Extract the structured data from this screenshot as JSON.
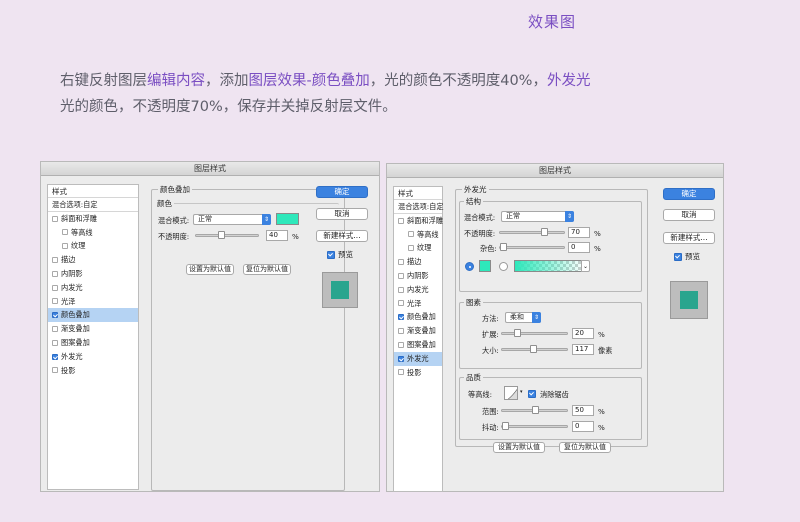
{
  "heading": "效果图",
  "instructions": {
    "p1": "右键反射图层",
    "h1": "编辑内容",
    "p2": "，添加",
    "h2": "图层效果-颜色叠加",
    "p3": "，光的颜色不透明度40%，",
    "h3": "外发光",
    "p4": "光的颜色，不透明度70%，保存并关掉反射层文件。"
  },
  "colors": {
    "accent": "#7a4ec2",
    "button_blue": "#3b82e0",
    "glow_color": "#2ee8bb",
    "preview_fill": "#2aa58e"
  },
  "dialog1": {
    "title": "图层样式",
    "list_header": "样式",
    "items": [
      {
        "label": "混合选项:自定",
        "checkbox": false,
        "checked": false,
        "sub": false,
        "selected": false
      },
      {
        "label": "斜面和浮雕",
        "checkbox": true,
        "checked": false,
        "sub": false,
        "selected": false
      },
      {
        "label": "等高线",
        "checkbox": true,
        "checked": false,
        "sub": true,
        "selected": false
      },
      {
        "label": "纹理",
        "checkbox": true,
        "checked": false,
        "sub": true,
        "selected": false
      },
      {
        "label": "描边",
        "checkbox": true,
        "checked": false,
        "sub": false,
        "selected": false
      },
      {
        "label": "内阴影",
        "checkbox": true,
        "checked": false,
        "sub": false,
        "selected": false
      },
      {
        "label": "内发光",
        "checkbox": true,
        "checked": false,
        "sub": false,
        "selected": false
      },
      {
        "label": "光泽",
        "checkbox": true,
        "checked": false,
        "sub": false,
        "selected": false
      },
      {
        "label": "颜色叠加",
        "checkbox": true,
        "checked": true,
        "sub": false,
        "selected": true
      },
      {
        "label": "渐变叠加",
        "checkbox": true,
        "checked": false,
        "sub": false,
        "selected": false
      },
      {
        "label": "图案叠加",
        "checkbox": true,
        "checked": false,
        "sub": false,
        "selected": false
      },
      {
        "label": "外发光",
        "checkbox": true,
        "checked": true,
        "sub": false,
        "selected": false
      },
      {
        "label": "投影",
        "checkbox": true,
        "checked": false,
        "sub": false,
        "selected": false
      }
    ],
    "section_title": "颜色叠加",
    "sub_title": "颜色",
    "blend_label": "混合模式:",
    "blend_value": "正常",
    "opacity_label": "不透明度:",
    "opacity_value": "40",
    "opacity_fraction": 0.4,
    "unit": "%",
    "btn_default": "设置为默认值",
    "btn_reset": "复位为默认值",
    "ok": "确定",
    "cancel": "取消",
    "new_style": "新建样式...",
    "preview": "预览"
  },
  "dialog2": {
    "title": "图层样式",
    "list_header": "样式",
    "items": [
      {
        "label": "混合选项:自定",
        "checkbox": false,
        "checked": false,
        "sub": false,
        "selected": false
      },
      {
        "label": "斜面和浮雕",
        "checkbox": true,
        "checked": false,
        "sub": false,
        "selected": false
      },
      {
        "label": "等高线",
        "checkbox": true,
        "checked": false,
        "sub": true,
        "selected": false
      },
      {
        "label": "纹理",
        "checkbox": true,
        "checked": false,
        "sub": true,
        "selected": false
      },
      {
        "label": "描边",
        "checkbox": true,
        "checked": false,
        "sub": false,
        "selected": false
      },
      {
        "label": "内阴影",
        "checkbox": true,
        "checked": false,
        "sub": false,
        "selected": false
      },
      {
        "label": "内发光",
        "checkbox": true,
        "checked": false,
        "sub": false,
        "selected": false
      },
      {
        "label": "光泽",
        "checkbox": true,
        "checked": false,
        "sub": false,
        "selected": false
      },
      {
        "label": "颜色叠加",
        "checkbox": true,
        "checked": true,
        "sub": false,
        "selected": false
      },
      {
        "label": "渐变叠加",
        "checkbox": true,
        "checked": false,
        "sub": false,
        "selected": false
      },
      {
        "label": "图案叠加",
        "checkbox": true,
        "checked": false,
        "sub": false,
        "selected": false
      },
      {
        "label": "外发光",
        "checkbox": true,
        "checked": true,
        "sub": false,
        "selected": true
      },
      {
        "label": "投影",
        "checkbox": true,
        "checked": false,
        "sub": false,
        "selected": false
      }
    ],
    "section_title": "外发光",
    "structure": {
      "title": "结构",
      "blend_label": "混合模式:",
      "blend_value": "正常",
      "opacity_label": "不透明度:",
      "opacity_value": "70",
      "opacity_fraction": 0.7,
      "noise_label": "杂色:",
      "noise_value": "0",
      "noise_fraction": 0,
      "unit": "%"
    },
    "elements": {
      "title": "图素",
      "method_label": "方法:",
      "method_value": "柔和",
      "spread_label": "扩展:",
      "spread_value": "20",
      "spread_fraction": 0.2,
      "size_label": "大小:",
      "size_value": "117",
      "size_fraction": 0.47,
      "pct": "%",
      "px": "像素"
    },
    "quality": {
      "title": "品质",
      "contour_label": "等高线:",
      "antialias_label": "消除锯齿",
      "range_label": "范围:",
      "range_value": "50",
      "range_fraction": 0.5,
      "jitter_label": "抖动:",
      "jitter_value": "0",
      "jitter_fraction": 0,
      "unit": "%"
    },
    "btn_default": "设置为默认值",
    "btn_reset": "复位为默认值",
    "ok": "确定",
    "cancel": "取消",
    "new_style": "新建样式...",
    "preview": "预览"
  }
}
